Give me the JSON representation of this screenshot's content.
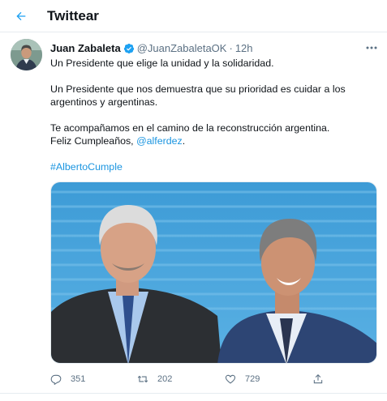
{
  "header": {
    "title": "Twittear",
    "back_icon": "arrow-left-icon"
  },
  "tweet": {
    "author_name": "Juan Zabaleta",
    "verified_icon": "verified-badge-icon",
    "handle": "@JuanZabaletaOK",
    "separator": "·",
    "time": "12h",
    "more_icon": "more-horizontal-icon",
    "lines": {
      "l1": "Un Presidente que elige la unidad y la solidaridad.",
      "l2": "Un Presidente que nos demuestra que su prioridad es cuidar a los",
      "l3": "argentinos y argentinas.",
      "l4": "Te acompañamos en el camino de la reconstrucción argentina.",
      "l5_prefix": "Feliz Cumpleaños, ",
      "l5_mention": "@alferdez",
      "l5_suffix": ".",
      "hashtag": "#AlbertoCumple"
    },
    "actions": {
      "reply_count": "351",
      "retweet_count": "202",
      "like_count": "729"
    }
  },
  "colors": {
    "accent": "#1da1f2",
    "link": "#1b95e0",
    "muted": "#5b7083",
    "border": "#e6ecf0"
  }
}
